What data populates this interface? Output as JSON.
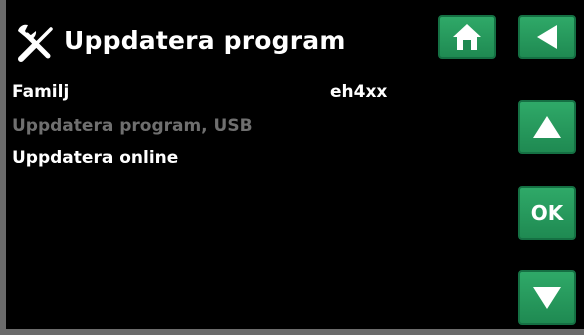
{
  "title": {
    "text": "Uppdatera program",
    "icon": "tools-icon"
  },
  "nav": {
    "home_icon": "home-icon",
    "back_icon": "back-arrow-icon",
    "up_icon": "up-arrow-icon",
    "ok_label": "OK",
    "down_icon": "down-arrow-icon"
  },
  "menu": {
    "familj": {
      "label": "Familj",
      "value": "eh4xx"
    },
    "usb": {
      "label": "Uppdatera program, USB",
      "state": "disabled"
    },
    "online": {
      "label": "Uppdatera online"
    }
  },
  "colors": {
    "background": "#000000",
    "button": "#2fa968",
    "text": "#ffffff",
    "disabled_text": "#6f6f6f",
    "frame": "#6b6b6b"
  }
}
